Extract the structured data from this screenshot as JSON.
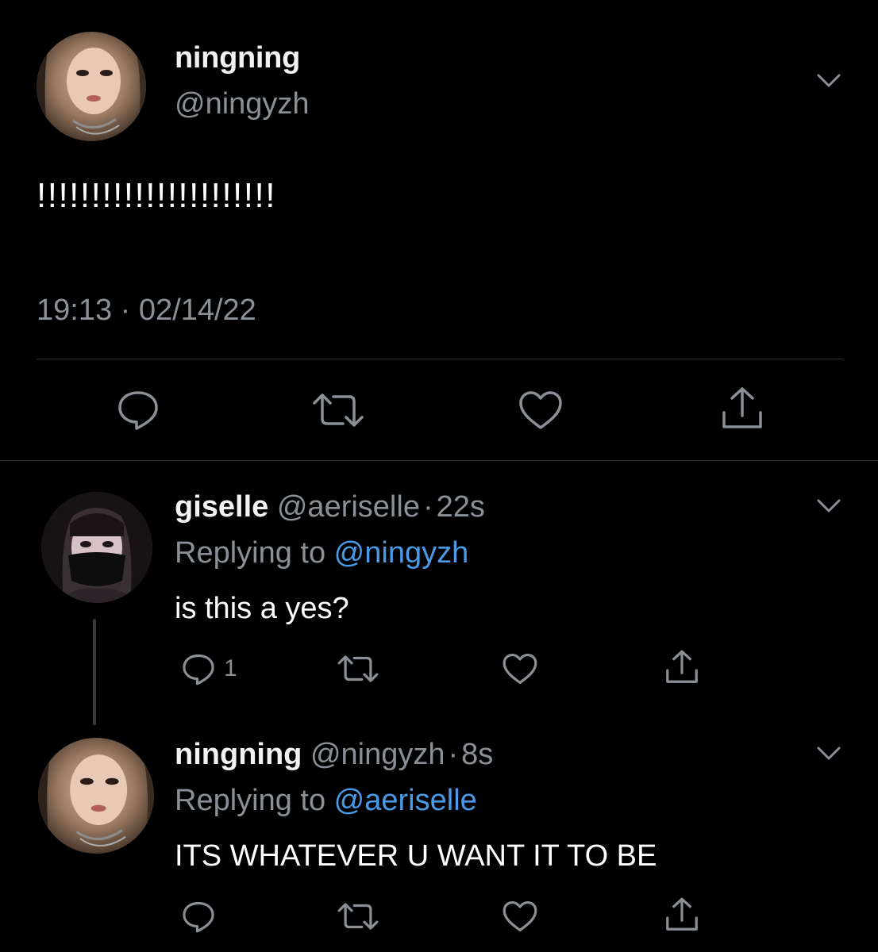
{
  "main_tweet": {
    "display_name": "ningning",
    "handle": "@ningyzh",
    "text": "!!!!!!!!!!!!!!!!!!!!!!",
    "timestamp": "19:13 · 02/14/22"
  },
  "replies": [
    {
      "display_name": "giselle",
      "handle": "@aeriselle",
      "separator": "·",
      "age": "22s",
      "replying_prefix": "Replying to ",
      "replying_to": "@ningyzh",
      "text": "is this a yes?",
      "reply_count": "1"
    },
    {
      "display_name": "ningning",
      "handle": "@ningyzh",
      "separator": "·",
      "age": "8s",
      "replying_prefix": "Replying to ",
      "replying_to": "@aeriselle",
      "text": "ITS WHATEVER U WANT IT TO BE"
    }
  ],
  "icons": {
    "reply": "reply-icon",
    "retweet": "retweet-icon",
    "like": "heart-icon",
    "share": "share-icon",
    "more": "chevron-down-icon"
  },
  "colors": {
    "background": "#000000",
    "text": "#ffffff",
    "secondary": "#8b9096",
    "mention": "#4a9ae8",
    "divider": "#2f3336"
  }
}
